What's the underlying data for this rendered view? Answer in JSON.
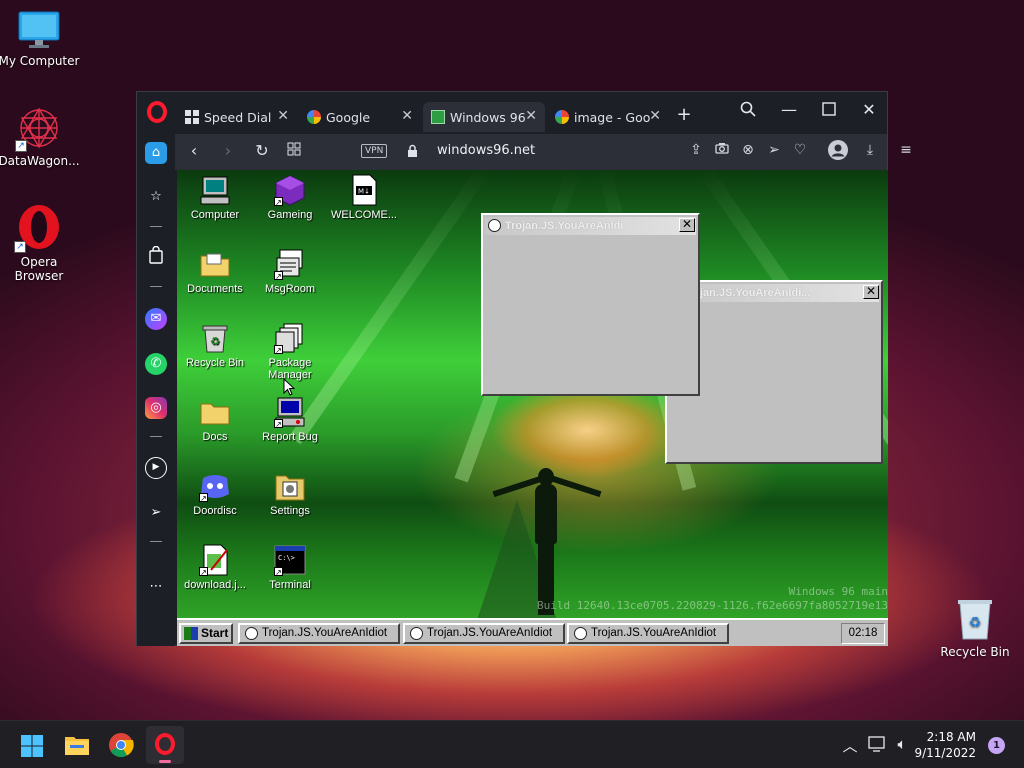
{
  "desktop": {
    "icons": [
      {
        "label": "My Computer"
      },
      {
        "label": "DataWagon..."
      },
      {
        "label": "Opera Browser"
      },
      {
        "label": "Recycle Bin"
      }
    ]
  },
  "browser": {
    "tabs": [
      {
        "label": "Speed Dial",
        "active": false
      },
      {
        "label": "Google",
        "active": false
      },
      {
        "label": "Windows 96",
        "active": true
      },
      {
        "label": "image - Goo",
        "active": false
      }
    ],
    "new_tab_symbol": "+",
    "vpn_label": "VPN",
    "url": "windows96.net"
  },
  "w96": {
    "icons": [
      {
        "label": "Computer"
      },
      {
        "label": "Gameing"
      },
      {
        "label": "WELCOME..."
      },
      {
        "label": "Documents"
      },
      {
        "label": "MsgRoom"
      },
      {
        "label": "Recycle Bin"
      },
      {
        "label": "Package Manager"
      },
      {
        "label": "Docs"
      },
      {
        "label": "Report Bug"
      },
      {
        "label": "Doordisc"
      },
      {
        "label": "Settings"
      },
      {
        "label": "download.j..."
      },
      {
        "label": "Terminal"
      }
    ],
    "windows": [
      {
        "title": "Trojan.JS.YouAreAnIdi"
      },
      {
        "title": "rojan.JS.YouAreAnIdi..."
      }
    ],
    "watermark": {
      "line1": "Windows 96 main",
      "line2": "Build 12640.13ce0705.220829-1126.f62e6697fa8052719e13"
    },
    "taskbar": {
      "start_label": "Start",
      "tasks": [
        "Trojan.JS.YouAreAnIdiot",
        "Trojan.JS.YouAreAnIdiot",
        "Trojan.JS.YouAreAnIdiot"
      ],
      "clock": "02:18"
    }
  },
  "taskbar": {
    "time": "2:18 AM",
    "date": "9/11/2022",
    "notification_count": "1"
  },
  "colors": {
    "opera_red": "#ff1b2d",
    "browser_dark": "#1d1f26",
    "win96_grey": "#c0c0c0"
  }
}
